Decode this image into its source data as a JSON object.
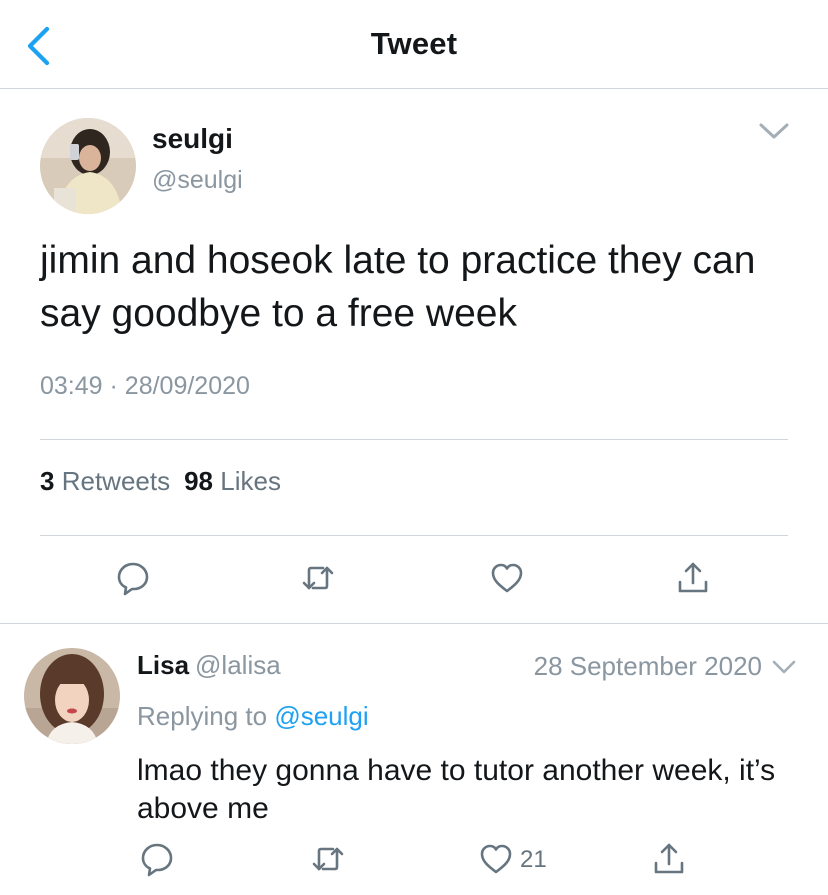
{
  "header": {
    "title": "Tweet",
    "back_icon": "chevron-left-icon"
  },
  "tweet": {
    "author_name": "seulgi",
    "author_handle": "@seulgi",
    "text": "jimin and hoseok late to practice they can say goodbye to a free week",
    "time": "03:49",
    "separator": "·",
    "date": "28/09/2020",
    "retweets_count": "3",
    "retweets_label": "Retweets",
    "likes_count": "98",
    "likes_label": "Likes",
    "actions": [
      "reply-icon",
      "retweet-icon",
      "like-icon",
      "share-icon"
    ]
  },
  "reply": {
    "author_name": "Lisa",
    "author_handle": "@lalisa",
    "date": "28 September 2020",
    "replying_prefix": "Replying to",
    "replying_to": "@seulgi",
    "text": "lmao they gonna have to tutor another week, it’s above me",
    "like_count": "21",
    "actions": [
      "reply-icon",
      "retweet-icon",
      "like-icon",
      "share-icon"
    ]
  },
  "colors": {
    "accent": "#1da1f2",
    "secondary_text": "#8a96a0",
    "icon": "#66757f",
    "divider": "#cfd5da"
  }
}
